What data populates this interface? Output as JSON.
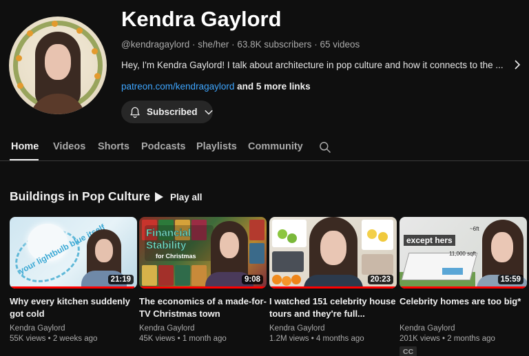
{
  "channel": {
    "name": "Kendra Gaylord",
    "handle": "@kendragaylord",
    "pronouns": "she/her",
    "subscribers": "63.8K subscribers",
    "videos": "65 videos",
    "separator": "·",
    "description": "Hey, I'm Kendra Gaylord! I talk about architecture in pop culture and how it connects to the ...",
    "link_text": "patreon.com/kendragaylord",
    "more_links": "and 5 more links",
    "subscribe_label": "Subscribed"
  },
  "tabs": [
    {
      "label": "Home",
      "active": true
    },
    {
      "label": "Videos"
    },
    {
      "label": "Shorts"
    },
    {
      "label": "Podcasts"
    },
    {
      "label": "Playlists"
    },
    {
      "label": "Community"
    }
  ],
  "shelf": {
    "title": "Buildings in Pop Culture",
    "play_all": "Play all"
  },
  "videos": [
    {
      "title": "Why every kitchen suddenly got cold",
      "channel": "Kendra Gaylord",
      "views": "55K views",
      "age": "2 weeks ago",
      "duration": "21:19",
      "thumb_text": "your lightbulb blue itself",
      "watched_fraction": 0.98
    },
    {
      "title": "The economics of a made-for-TV Christmas town",
      "channel": "Kendra Gaylord",
      "views": "45K views",
      "age": "1 month ago",
      "duration": "9:08",
      "thumb_text_1": "Financial",
      "thumb_text_2": "Stability",
      "thumb_text_3": "for Christmas",
      "watched_fraction": 1.0
    },
    {
      "title": "I watched 151 celebrity house tours and they're full...",
      "channel": "Kendra Gaylord",
      "views": "1.2M views",
      "age": "4 months ago",
      "duration": "20:23",
      "watched_fraction": 1.0
    },
    {
      "title": "Celebrity homes are too big*",
      "channel": "Kendra Gaylord",
      "views": "201K views",
      "age": "2 months ago",
      "duration": "15:59",
      "thumb_text_1": "except hers",
      "thumb_text_2": "11,000 sqft",
      "thumb_text_3": "~6ft",
      "cc": "CC",
      "watched_fraction": 1.0
    }
  ],
  "icons": {
    "bell": "bell-icon",
    "caret": "chevron-down-icon",
    "more": "chevron-right-icon",
    "search": "search-icon",
    "play": "play-icon"
  },
  "colors": {
    "background": "#0f0f0f",
    "link": "#3ea6ff",
    "progress": "#ff0000",
    "chip": "#272727"
  }
}
